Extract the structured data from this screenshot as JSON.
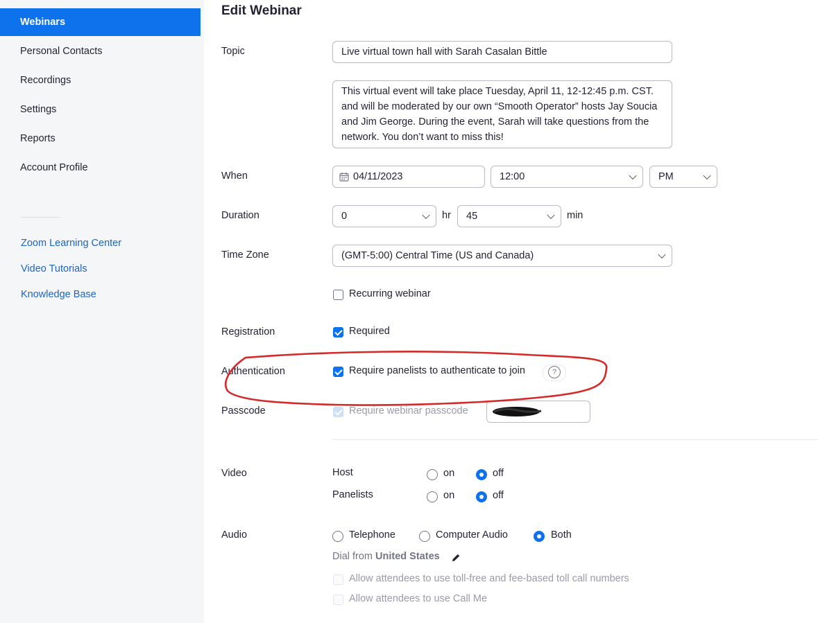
{
  "sidebar": {
    "items": [
      {
        "label": "Webinars",
        "active": true
      },
      {
        "label": "Personal Contacts"
      },
      {
        "label": "Recordings"
      },
      {
        "label": "Settings"
      },
      {
        "label": "Reports"
      },
      {
        "label": "Account Profile"
      }
    ],
    "links": [
      "Zoom Learning Center",
      "Video Tutorials",
      "Knowledge Base"
    ]
  },
  "page": {
    "title": "Edit Webinar"
  },
  "form": {
    "topic": {
      "label": "Topic",
      "value": "Live virtual town hall with Sarah Casalan Bittle"
    },
    "description": {
      "value": "This virtual event will take place Tuesday, April 11, 12-12:45 p.m. CST. and will be moderated by our own “Smooth Operator” hosts Jay Soucia and Jim George. During the event, Sarah will take questions from the network. You don’t want to miss this!"
    },
    "when": {
      "label": "When",
      "date": "04/11/2023",
      "time": "12:00",
      "ampm": "PM"
    },
    "duration": {
      "label": "Duration",
      "hours": "0",
      "hr_unit": "hr",
      "minutes": "45",
      "min_unit": "min"
    },
    "time_zone": {
      "label": "Time Zone",
      "value": "(GMT-5:00) Central Time (US and Canada)"
    },
    "recurring": {
      "label": "Recurring webinar",
      "checked": false
    },
    "registration": {
      "label": "Registration",
      "option": "Required",
      "checked": true
    },
    "authentication": {
      "label": "Authentication",
      "option": "Require panelists to authenticate to join",
      "checked": true,
      "help": "?"
    },
    "passcode": {
      "label": "Passcode",
      "option": "Require webinar passcode",
      "checked": true,
      "value": ""
    },
    "video": {
      "label": "Video",
      "host": {
        "label": "Host",
        "on": "on",
        "off": "off",
        "selected": "off"
      },
      "panelists": {
        "label": "Panelists",
        "on": "on",
        "off": "off",
        "selected": "off"
      }
    },
    "audio": {
      "label": "Audio",
      "options": [
        "Telephone",
        "Computer Audio",
        "Both"
      ],
      "selected": "Both",
      "dial_prefix": "Dial from",
      "dial_country": "United States",
      "toll_option": "Allow attendees to use toll-free and fee-based toll call numbers",
      "callme_option": "Allow attendees to use Call Me"
    }
  },
  "colors": {
    "accent": "#0e72ed",
    "annotation": "#d42a2a",
    "sidebar_bg": "#f5f6f8"
  }
}
